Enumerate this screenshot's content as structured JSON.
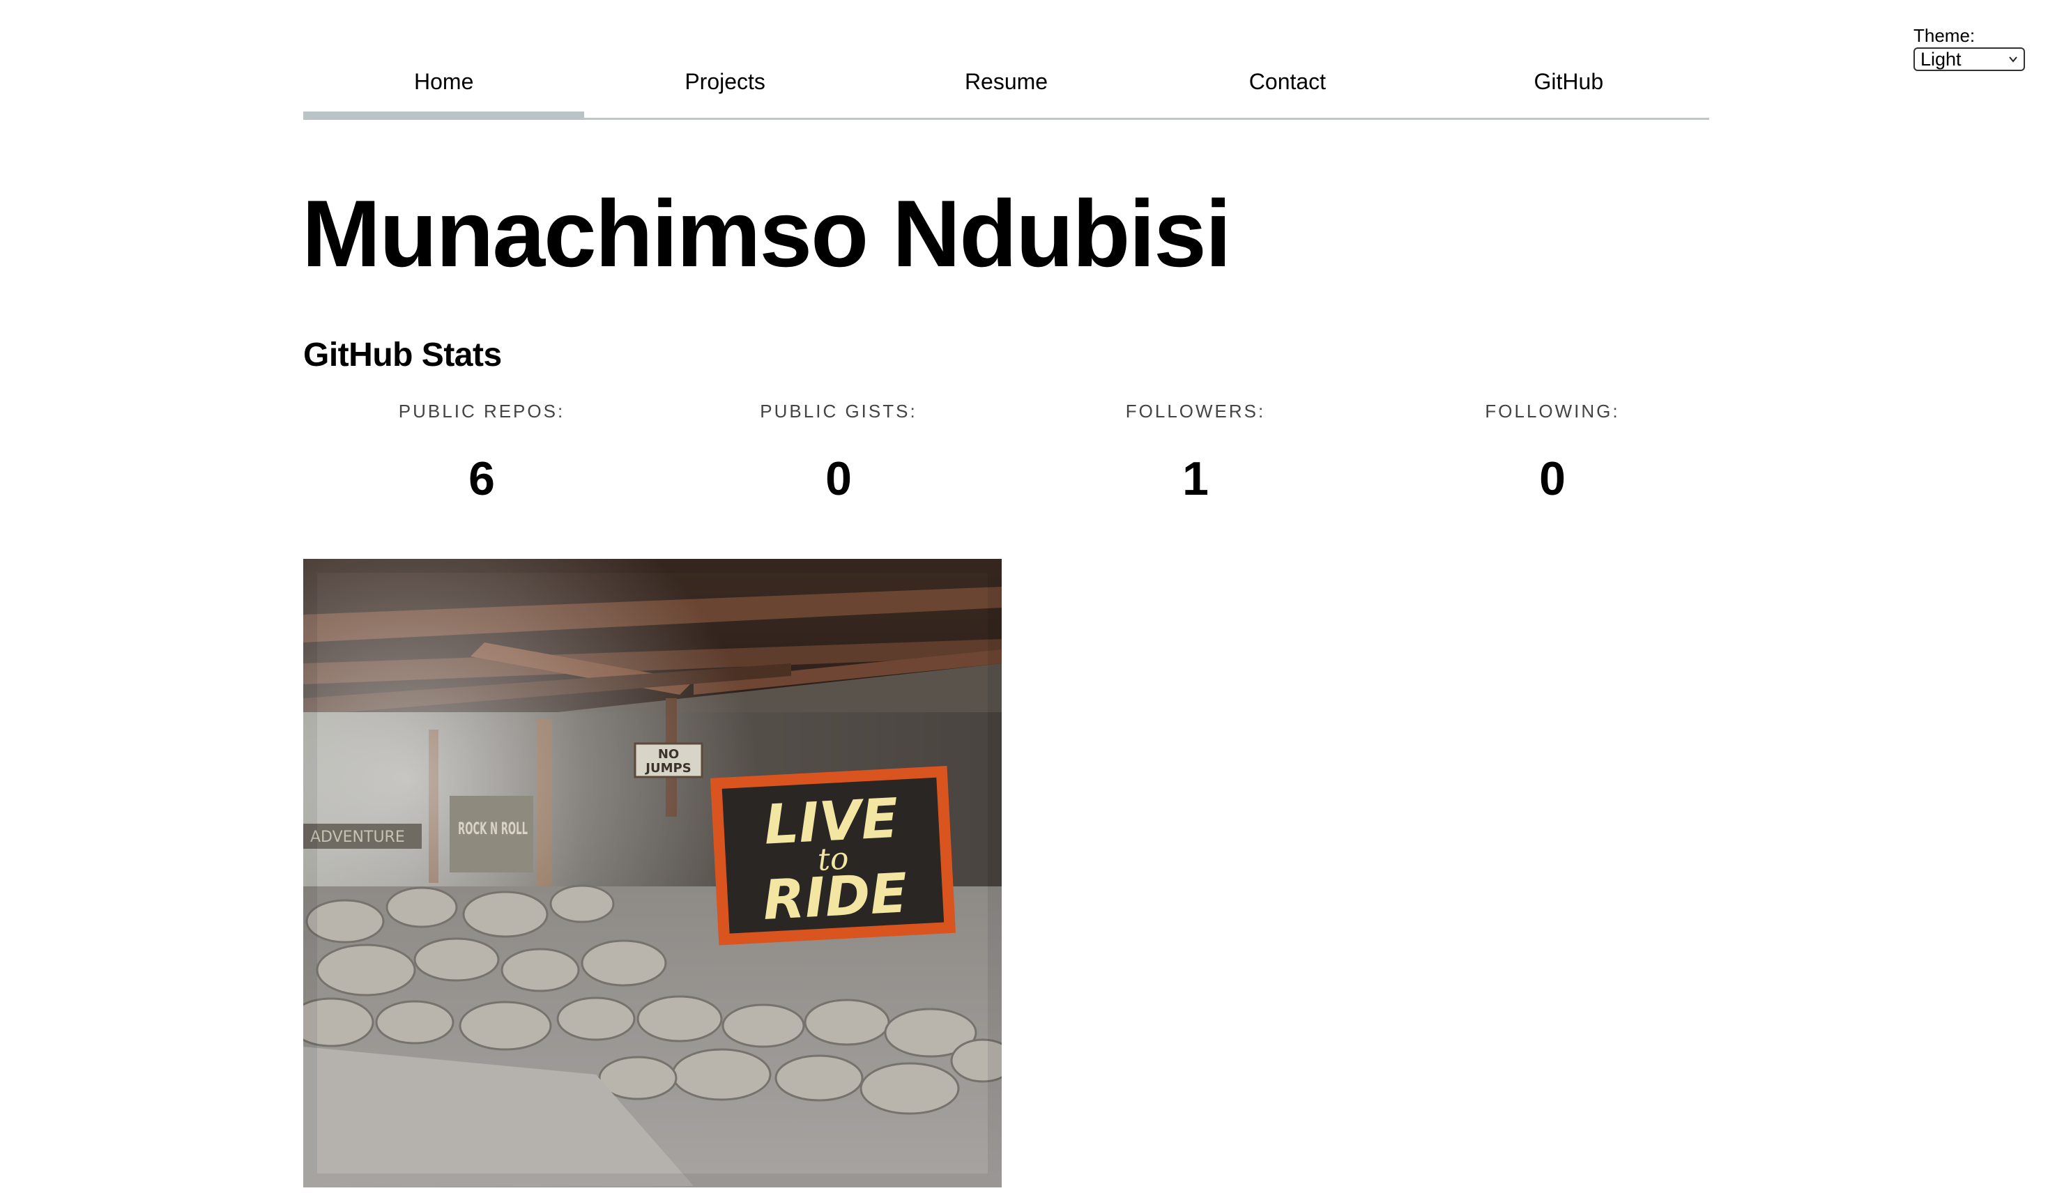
{
  "theme": {
    "label": "Theme:",
    "selected": "Light"
  },
  "nav": {
    "items": [
      {
        "label": "Home",
        "active": true
      },
      {
        "label": "Projects",
        "active": false
      },
      {
        "label": "Resume",
        "active": false
      },
      {
        "label": "Contact",
        "active": false
      },
      {
        "label": "GitHub",
        "active": false
      }
    ]
  },
  "header": {
    "name": "Munachimso Ndubisi"
  },
  "stats": {
    "heading": "GitHub Stats",
    "items": [
      {
        "label": "PUBLIC REPOS:",
        "value": "6"
      },
      {
        "label": "PUBLIC GISTS:",
        "value": "0"
      },
      {
        "label": "FOLLOWERS:",
        "value": "1"
      },
      {
        "label": "FOLLOWING:",
        "value": "0"
      }
    ]
  },
  "photo": {
    "sign_main_line1": "LIVE",
    "sign_main_line2": "to",
    "sign_main_line3": "RIDE",
    "sign_small_line1": "NO",
    "sign_small_line2": "JUMPS",
    "sign_left": "ROCK N ROLL",
    "sign_far_left": "ADVENTURE"
  },
  "colors": {
    "nav_active_bar": "#bac3c6",
    "nav_border": "#bfc6c8",
    "sign_border": "#d9541e",
    "sign_text": "#f3e6a2"
  }
}
